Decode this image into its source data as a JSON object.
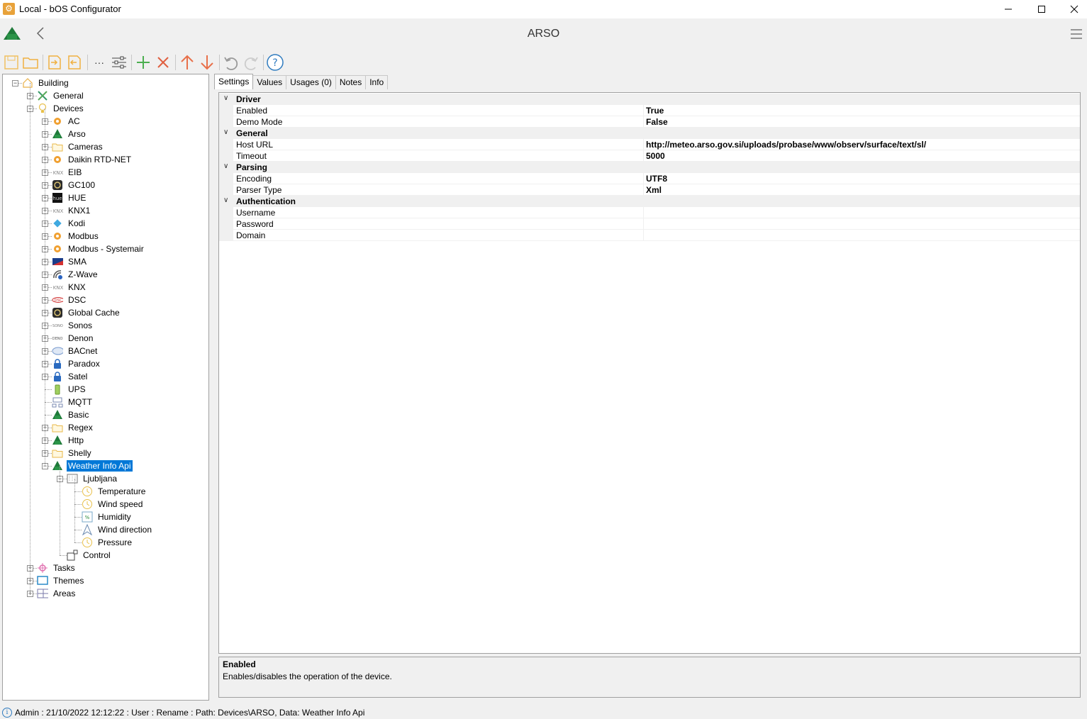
{
  "window": {
    "title": "Local - bOS Configurator"
  },
  "header": {
    "title": "ARSO"
  },
  "tree": {
    "root": "Building",
    "general": "General",
    "devices": "Devices",
    "device_items": [
      "AC",
      "Arso",
      "Cameras",
      "Daikin RTD-NET",
      "EIB",
      "GC100",
      "HUE",
      "KNX1",
      "Kodi",
      "Modbus",
      "Modbus - Systemair",
      "SMA",
      "Z-Wave",
      "KNX",
      "DSC",
      "Global Cache",
      "Sonos",
      "Denon",
      "BACnet",
      "Paradox",
      "Satel",
      "UPS",
      "MQTT",
      "Basic",
      "Regex",
      "Http",
      "Shelly",
      "Weather Info Api"
    ],
    "location": "Ljubljana",
    "sensors": [
      "Temperature",
      "Wind speed",
      "Humidity",
      "Wind direction",
      "Pressure"
    ],
    "control": "Control",
    "tasks": "Tasks",
    "themes": "Themes",
    "areas": "Areas"
  },
  "tabs": [
    "Settings",
    "Values",
    "Usages (0)",
    "Notes",
    "Info"
  ],
  "properties": {
    "driver": {
      "label": "Driver",
      "enabled_label": "Enabled",
      "enabled": "True",
      "demo_label": "Demo Mode",
      "demo": "False"
    },
    "general": {
      "label": "General",
      "host_label": "Host URL",
      "host": "http://meteo.arso.gov.si/uploads/probase/www/observ/surface/text/sl/",
      "timeout_label": "Timeout",
      "timeout": "5000"
    },
    "parsing": {
      "label": "Parsing",
      "encoding_label": "Encoding",
      "encoding": "UTF8",
      "parser_label": "Parser Type",
      "parser": "Xml"
    },
    "auth": {
      "label": "Authentication",
      "username_label": "Username",
      "password_label": "Password",
      "domain_label": "Domain"
    }
  },
  "help": {
    "title": "Enabled",
    "description": "Enables/disables the operation of the device."
  },
  "status": {
    "text": "Admin : 21/10/2022 12:12:22 : User : Rename : Path: Devices\\ARSO, Data: Weather Info Api"
  }
}
